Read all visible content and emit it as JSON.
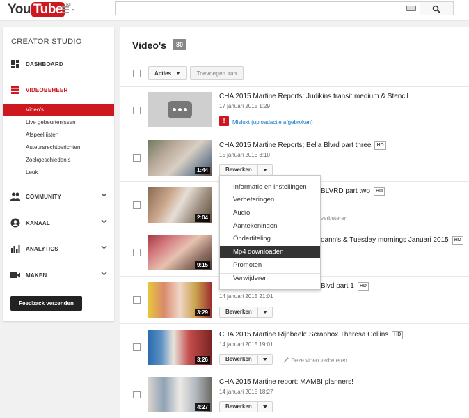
{
  "header": {
    "logo_you": "You",
    "logo_tube": "Tube",
    "logo_region": "NL",
    "search_value": ""
  },
  "sidebar": {
    "title": "CREATOR STUDIO",
    "items": [
      {
        "label": "DASHBOARD",
        "icon": "dashboard-icon"
      },
      {
        "label": "VIDEOBEHEER",
        "icon": "video-manager-icon"
      },
      {
        "label": "COMMUNITY",
        "icon": "community-icon"
      },
      {
        "label": "KANAAL",
        "icon": "channel-icon"
      },
      {
        "label": "ANALYTICS",
        "icon": "analytics-icon"
      },
      {
        "label": "MAKEN",
        "icon": "create-icon"
      }
    ],
    "sub_items": [
      "Video's",
      "Live gebeurtenissen",
      "Afspeellijsten",
      "Auteursrechtberichten",
      "Zoekgeschiedenis",
      "Leuk"
    ],
    "feedback_label": "Feedback verzenden"
  },
  "main": {
    "title": "Video's",
    "count": "80",
    "actions_label": "Acties",
    "add_label": "Toevoegen aan",
    "edit_label": "Bewerken",
    "improve_label": "Deze video verbeteren",
    "videos": [
      {
        "title": "CHA 2015 Martine Reports: Judikins transit medium & Stencil",
        "date": "17 januari 2015 1:29",
        "duration": "",
        "hd": "",
        "error": "Mislukt (uploadactie afgebroken)"
      },
      {
        "title": "CHA 2015 Martine Reports; Bella Blvrd part three",
        "date": "15 januari 2015 3:10",
        "duration": "1:44",
        "hd": "HD"
      },
      {
        "title": "BLVRD part two",
        "date": "",
        "duration": "2:04",
        "hd": "HD",
        "improve": "verbeteren"
      },
      {
        "title": "oann's & Tuesday mornings Januari 2015",
        "date": "",
        "duration": "9:15",
        "hd": "HD"
      },
      {
        "title": "Blvd part 1",
        "date": "14 januari 2015 21:01",
        "duration": "3:29",
        "hd": "HD"
      },
      {
        "title": "CHA 2015 Martine Rijnbeek: Scrapbox Theresa Collins",
        "date": "14 januari 2015 19:01",
        "duration": "3:26",
        "hd": "HD"
      },
      {
        "title": "CHA 2015 Martine report: MAMBI planners!",
        "date": "14 januari 2015 18:27",
        "duration": "4:27",
        "hd": ""
      }
    ]
  },
  "menu": {
    "items": [
      "Informatie en instellingen",
      "Verbeteringen",
      "Audio",
      "Aantekeningen",
      "Ondertiteling",
      "Mp4 downloaden",
      "Promoten",
      "Verwijderen"
    ]
  },
  "colors": {
    "accent": "#cc181e",
    "link": "#167ac6"
  }
}
